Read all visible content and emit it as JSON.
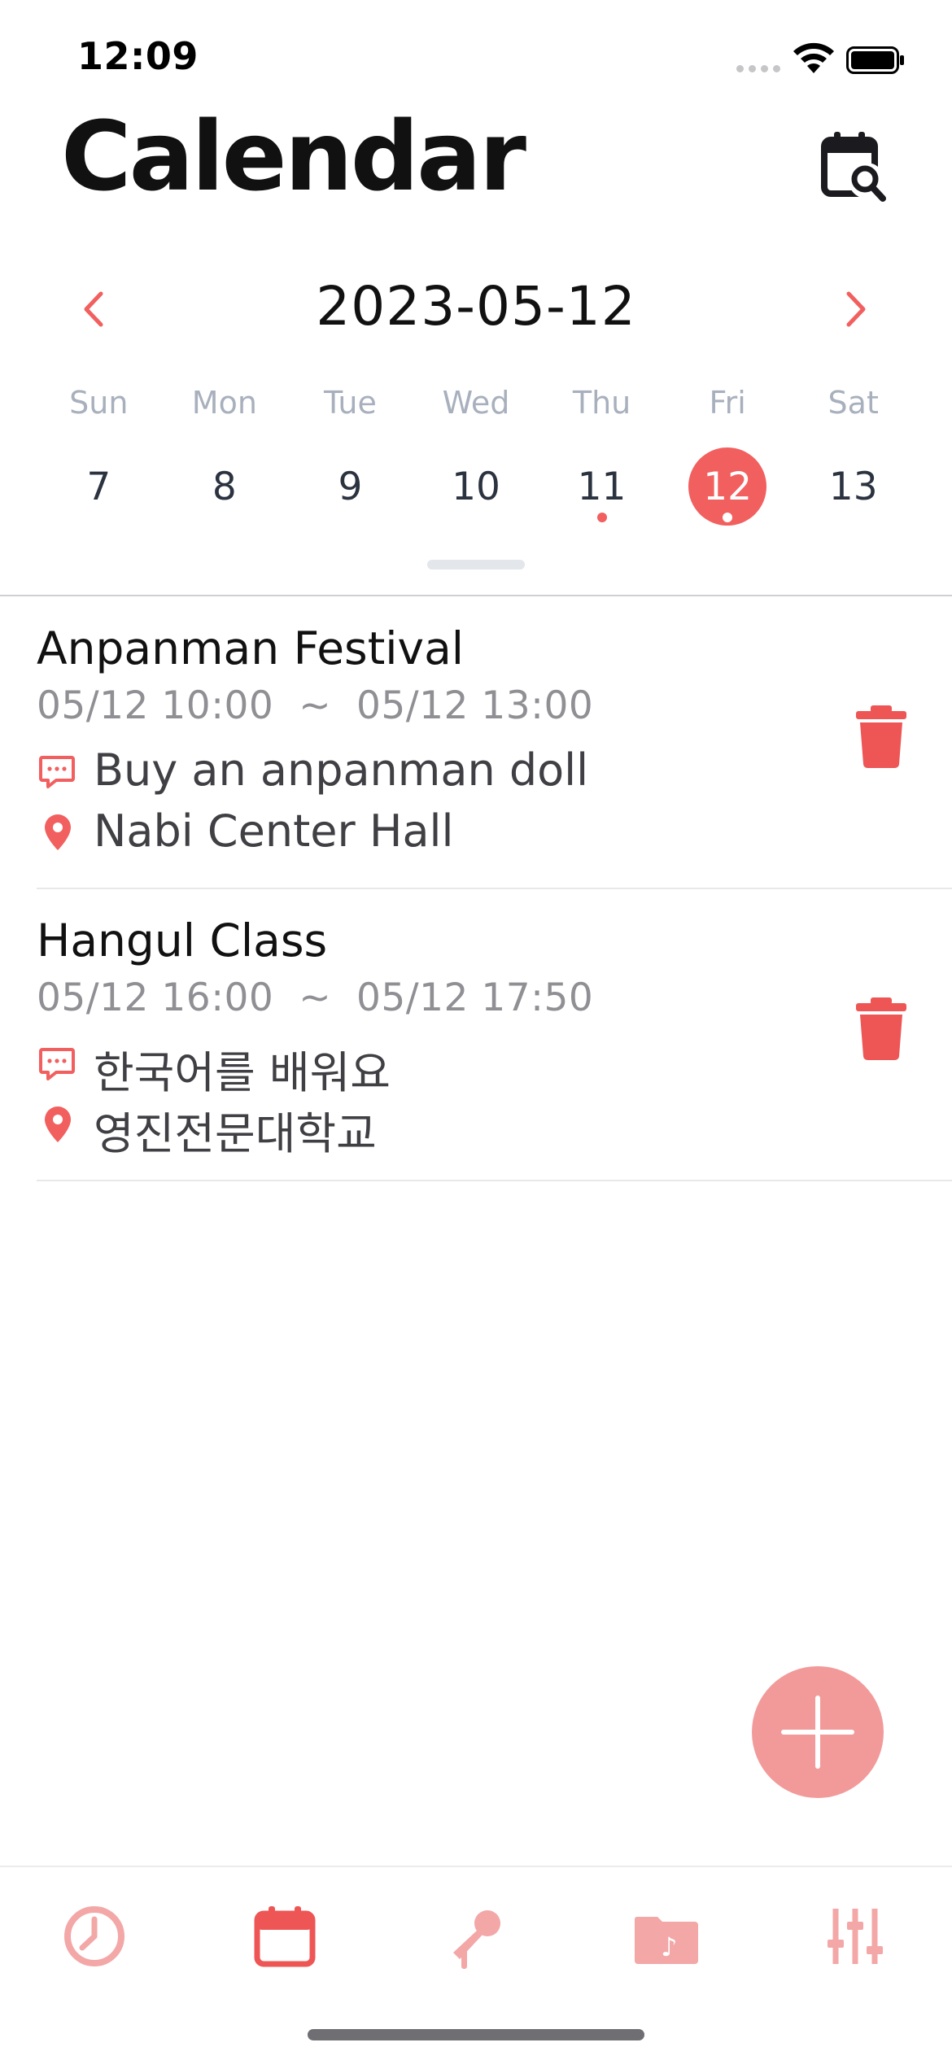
{
  "status_bar": {
    "time": "12:09"
  },
  "header": {
    "title": "Calendar"
  },
  "calendar": {
    "current_date": "2023-05-12",
    "weekdays": [
      "Sun",
      "Mon",
      "Tue",
      "Wed",
      "Thu",
      "Fri",
      "Sat"
    ],
    "days": [
      "7",
      "8",
      "9",
      "10",
      "11",
      "12",
      "13"
    ],
    "selected_day": "12",
    "days_with_events": [
      "11",
      "12"
    ]
  },
  "events": [
    {
      "title": "Anpanman Festival",
      "time": "05/12 10:00  ~  05/12 13:00",
      "note": "Buy an anpanman doll",
      "location": "Nabi Center Hall"
    },
    {
      "title": "Hangul Class",
      "time": "05/12 16:00  ~  05/12 17:50",
      "note": "한국어를 배워요",
      "location": "영진전문대학교"
    }
  ],
  "tabbar": {
    "items": [
      "clock-icon",
      "calendar-icon",
      "microphone-icon",
      "music-folder-icon",
      "sliders-icon"
    ],
    "active_index": 1
  },
  "colors": {
    "accent": "#f25f5f",
    "accent_light": "#f29a9a",
    "weekday_text": "#a8b0bd",
    "muted_text": "#8f8f94"
  }
}
